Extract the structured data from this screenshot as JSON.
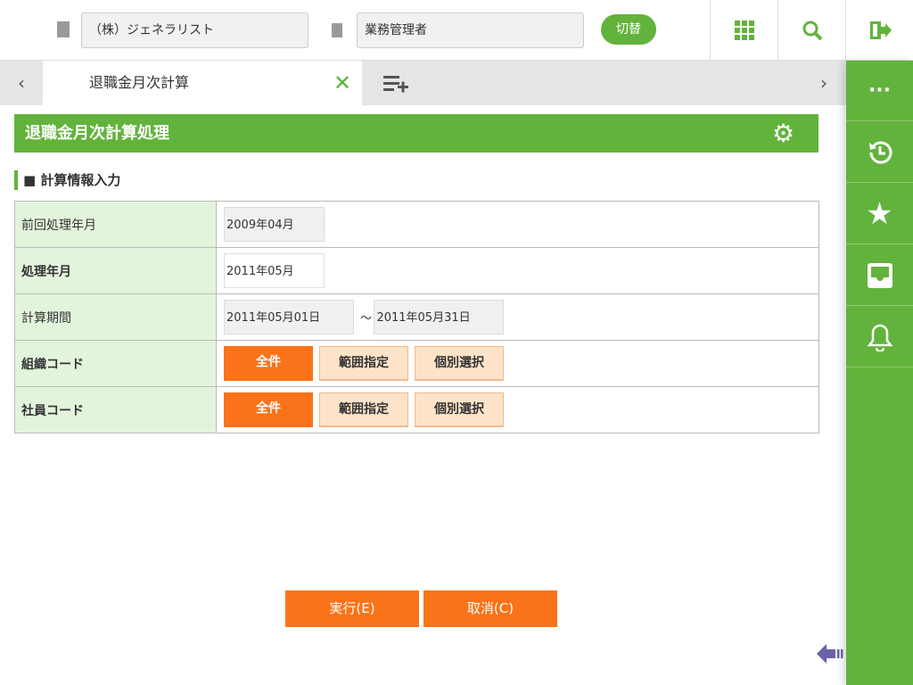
{
  "header": {
    "company": "（株）ジェネラリスト",
    "role": "業務管理者",
    "switch_label": "切替",
    "icons": [
      "building-icon",
      "clipboard-icon",
      "apps-grid-icon",
      "search-icon",
      "logout-icon"
    ]
  },
  "tabs": {
    "active_label": "退職金月次計算",
    "colors": {
      "accent": "#62b33c"
    }
  },
  "sidebar": {
    "items": [
      "more-icon",
      "history-icon",
      "star-icon",
      "inbox-icon",
      "bell-icon"
    ]
  },
  "page": {
    "title": "退職金月次計算処理",
    "section": "■ 計算情報入力"
  },
  "form": {
    "prev_label": "前回処理年月",
    "prev_value": "2009年04月",
    "month_label": "処理年月",
    "month_value": "2011年05月",
    "period_label": "計算期間",
    "period_from": "2011年05月01日",
    "period_sep": "～",
    "period_to": "2011年05月31日",
    "org_label": "組織コード",
    "emp_label": "社員コード",
    "btn_all": "全件",
    "btn_range": "範囲指定",
    "btn_indiv": "個別選択"
  },
  "footer": {
    "execute": "実行(E)",
    "cancel": "取消(C)"
  },
  "colors": {
    "green": "#62b33c",
    "orange": "#fa7319",
    "light_orange": "#fde3c9"
  }
}
